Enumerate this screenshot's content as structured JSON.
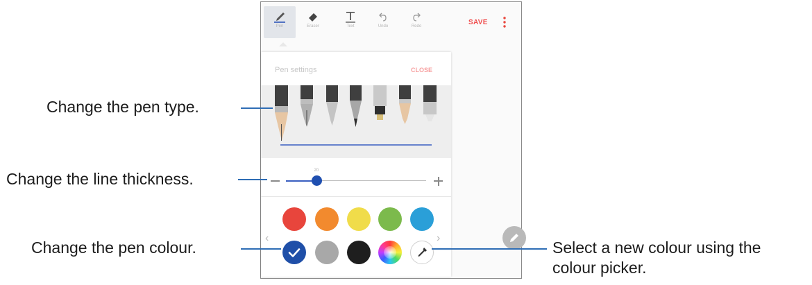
{
  "toolbar": {
    "tools": [
      {
        "label": "Pen",
        "icon": "pen-icon"
      },
      {
        "label": "Eraser",
        "icon": "eraser-icon"
      },
      {
        "label": "Text",
        "icon": "text-icon"
      },
      {
        "label": "Undo",
        "icon": "undo-icon"
      },
      {
        "label": "Redo",
        "icon": "redo-icon"
      }
    ],
    "save_label": "SAVE",
    "more_icon": "more-vertical-icon"
  },
  "pen_settings": {
    "title": "Pen settings",
    "close_label": "CLOSE",
    "pen_types": [
      "fountain-pen",
      "calligraphy-pen",
      "ballpoint-pen",
      "pencil",
      "marker",
      "brush",
      "highlighter"
    ],
    "selected_pen_index": 0,
    "thickness": {
      "value_label": "20",
      "level": 0.22,
      "decrease_icon": "minus-icon",
      "increase_icon": "plus-icon"
    },
    "colors": {
      "row1": [
        "#e8453c",
        "#f28a2e",
        "#f0dc4a",
        "#7cba4c",
        "#2a9fd8"
      ],
      "row2": [
        "#1f4fa8",
        "#a8a8a8",
        "#1e1e1e",
        "color-wheel",
        "color-picker"
      ],
      "selected": "#1f4fa8",
      "prev_icon": "chevron-left-icon",
      "next_icon": "chevron-right-icon"
    }
  },
  "fab_icon": "pen-icon",
  "callouts": {
    "pen_type": "Change the pen type.",
    "thickness": "Change the line thickness.",
    "pen_colour": "Change the pen colour.",
    "picker_line1": "Select a new colour using the",
    "picker_line2": "colour picker."
  },
  "accent_color": "#2e6db5"
}
